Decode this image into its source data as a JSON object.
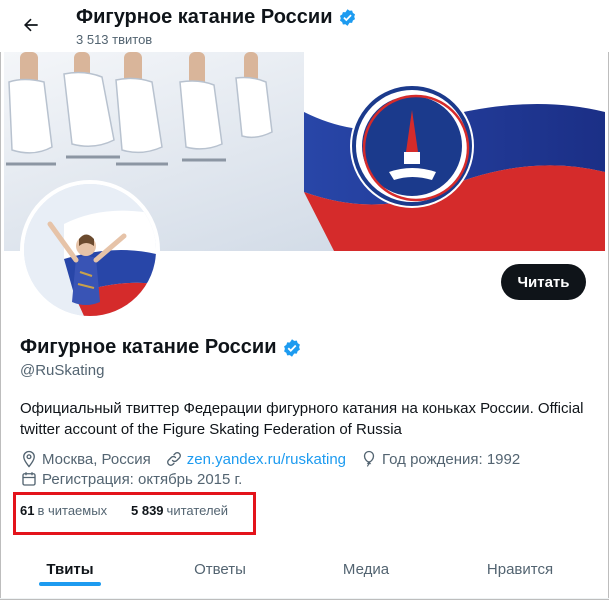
{
  "header": {
    "title": "Фигурное катание России",
    "tweet_count": "3 513 твитов"
  },
  "profile": {
    "name": "Фигурное катание России",
    "handle": "@RuSkating",
    "bio": "Официальный твиттер Федерации фигурного катания на коньках России. Official twitter account of the Figure Skating Federation of Russia",
    "location": "Москва, Россия",
    "website": "zen.yandex.ru/ruskating",
    "birthday": "Год рождения: 1992",
    "joined": "Регистрация: октябрь 2015 г.",
    "following_count": "61",
    "following_label": "в читаемых",
    "followers_count": "5 839",
    "followers_label": "читателей"
  },
  "actions": {
    "follow_label": "Читать"
  },
  "tabs": [
    {
      "label": "Твиты",
      "active": true
    },
    {
      "label": "Ответы",
      "active": false
    },
    {
      "label": "Медиа",
      "active": false
    },
    {
      "label": "Нравится",
      "active": false
    }
  ],
  "colors": {
    "accent": "#1d9bf0",
    "text": "#0f1419",
    "secondary_text": "#536471",
    "highlight_box": "#e3131b",
    "verified": "#1d9bf0"
  },
  "icons": {
    "back": "arrow-left-icon",
    "verified": "verified-badge-icon",
    "location": "location-pin-icon",
    "link": "link-icon",
    "birthday": "balloon-icon",
    "calendar": "calendar-icon"
  }
}
